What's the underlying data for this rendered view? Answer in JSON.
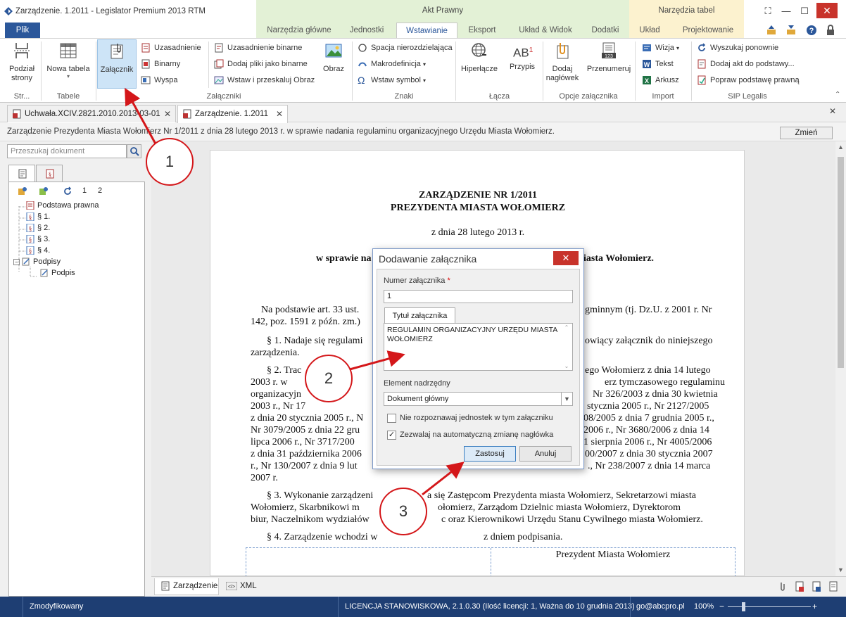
{
  "window": {
    "title": "Zarządzenie. 1.2011 - Legislator Premium 2013 RTM",
    "context_groups": [
      "Akt Prawny",
      "Narzędzia tabel"
    ]
  },
  "ribbon_tabs": {
    "plik": "Plik",
    "items": [
      "Narzędzia główne",
      "Jednostki",
      "Wstawianie",
      "Eksport",
      "Układ & Widok",
      "Dodatki",
      "Układ",
      "Projektowanie"
    ],
    "active": "Wstawianie"
  },
  "ribbon": {
    "podzial": "Podział\nstrony",
    "podzial_short": "Str...",
    "nowa_tabela": "Nowa tabela",
    "tabele_group": "Tabele",
    "zalacznik": "Załącznik",
    "uzasadnienie": "Uzasadnienie",
    "binarny": "Binarny",
    "wyspa": "Wyspa",
    "uzasadnienie_binarne": "Uzasadnienie binarne",
    "dodaj_pliki": "Dodaj pliki jako binarne",
    "wstaw_obraz": "Wstaw i przeskaluj Obraz",
    "obraz": "Obraz",
    "zalaczniki_group": "Załączniki",
    "spacja": "Spacja nierozdzielająca",
    "makro": "Makrodefinicja",
    "symbol": "Wstaw symbol",
    "znaki_group": "Znaki",
    "hiperlacze": "Hiperłącze",
    "przypis": "Przypis",
    "lacza_group": "Łącza",
    "dodaj_naglowek": "Dodaj\nnagłówek",
    "przenumeruj": "Przenumeruj",
    "opcje_group": "Opcje załącznika",
    "wizja": "Wizja",
    "tekst": "Tekst",
    "arkusz": "Arkusz",
    "import_group": "Import",
    "wyszukaj": "Wyszukaj ponownie",
    "dodaj_akt": "Dodaj akt do podstawy...",
    "popraw": "Popraw podstawę prawną",
    "sip_group": "SIP Legalis"
  },
  "doc_tabs": [
    "Uchwała.XCIV.2821.2010.2013-03-01",
    "Zarządzenie. 1.2011"
  ],
  "doc_header": {
    "title": "Zarządzenie Prezydenta Miasta Wołomierz Nr 1/2011 z dnia 28 lutego 2013 r. w sprawie nadania regulaminu organizacyjnego Urzędu Miasta Wołomierz.",
    "change": "Zmień"
  },
  "left_panel": {
    "search_placeholder": "Przeszukaj dokument",
    "levels": [
      "1",
      "2"
    ],
    "tree": [
      "Podstawa prawna",
      "§ 1.",
      "§ 2.",
      "§ 3.",
      "§ 4.",
      "Podpisy",
      "Podpis"
    ]
  },
  "document": {
    "h1": "ZARZĄDZENIE NR 1/2011",
    "h2": "PREZYDENTA MIASTA WOŁOMIERZ",
    "date": "z dnia 28 lutego 2013 r.",
    "subject_left": "w sprawie na",
    "subject_right": "iasta Wołomierz.",
    "basis_left": "Na podstawie art. 33 ust.",
    "basis_right": "gminnym (tj. Dz.U. z 2001 r. Nr",
    "basis_line2": "142, poz. 1591 z późn. zm.)",
    "p1_left": "§ 1. Nadaje się regulami",
    "p1_right": "owiący załącznik do niniejszego",
    "p1_line2": "zarządzenia.",
    "p2_l1_left": "§ 2. Trac",
    "p2_l1_right": "ego Wołomierz z dnia 14 lutego",
    "p2_l2_left": "2003 r. w",
    "p2_l2_right": "erz tymczasowego regulaminu",
    "p2_l3_left": "organizacyjn",
    "p2_l3_right": "Nr 326/2003 z dnia 30 kwietnia",
    "p2_l4_left": "2003 r., Nr 17",
    "p2_l4_right": "stycznia 2005 r., Nr 2127/2005",
    "p2_l5_left": "z dnia 20 stycznia 2005 r., N",
    "p2_l5_right": "08/2005 z dnia 7 grudnia 2005 r.,",
    "p2_l6_left": "Nr 3079/2005 z dnia 22 gru",
    "p2_l6_right": "2006 r., Nr 3680/2006 z dnia 14",
    "p2_l7_left": "lipca 2006 r., Nr 3717/200",
    "p2_l7_right": "1 sierpnia 2006 r., Nr 4005/2006",
    "p2_l8_left": "z dnia 31 października 2006",
    "p2_l8_right": "00/2007 z dnia 30 stycznia 2007",
    "p2_l9_left": "r., Nr 130/2007 z dnia 9 lut",
    "p2_l9_right": "., Nr 238/2007 z dnia 14 marca",
    "p2_l10": "2007 r.",
    "p3_l1_left": "§ 3. Wykonanie zarządzeni",
    "p3_l1_right": "a się Zastępcom Prezydenta miasta Wołomierz, Sekretarzowi miasta",
    "p3_l2_left": "Wołomierz, Skarbnikowi m",
    "p3_l2_right": "ołomierz, Zarządom Dzielnic miasta Wołomierz, Dyrektorom",
    "p3_l3_left": "biur, Naczelnikom wydziałów",
    "p3_l3_right": "c oraz Kierownikowi Urzędu Stanu Cywilnego miasta Wołomierz.",
    "p4_left": "§ 4. Zarządzenie wchodzi w",
    "p4_right": "z dniem podpisania.",
    "signature": "Prezydent Miasta Wołomierz"
  },
  "bottom_tabs": [
    "Zarządzenie",
    "XML"
  ],
  "status": {
    "state": "Zmodyfikowany",
    "license": "LICENCJA STANOWISKOWA, 2.1.0.30 (Ilość licencji: 1, Ważna do 10 grudnia 2013)",
    "email": "go@abcpro.pl",
    "zoom": "100%"
  },
  "dialog": {
    "title": "Dodawanie załącznika",
    "number_label": "Numer załącznika",
    "required_mark": "*",
    "number_value": "1",
    "title_tab": "Tytuł załącznika",
    "title_value": "REGULAMIN ORGANIZACYJNY URZĘDU MIASTA WOŁOMIERZ",
    "parent_label": "Element nadrzędny",
    "parent_value": "Dokument główny",
    "chk1": "Nie rozpoznawaj jednostek w tym załączniku",
    "chk1_checked": false,
    "chk2": "Zezwalaj na automatyczną zmianę nagłówka",
    "chk2_checked": true,
    "apply": "Zastosuj",
    "cancel": "Anuluj"
  },
  "callouts": [
    "1",
    "2",
    "3"
  ],
  "colors": {
    "accent": "#2b579a",
    "statusbar": "#1e3e73",
    "context_green": "#e3f1d6",
    "context_yellow": "#fcf2cf",
    "callout": "#d4171a"
  }
}
